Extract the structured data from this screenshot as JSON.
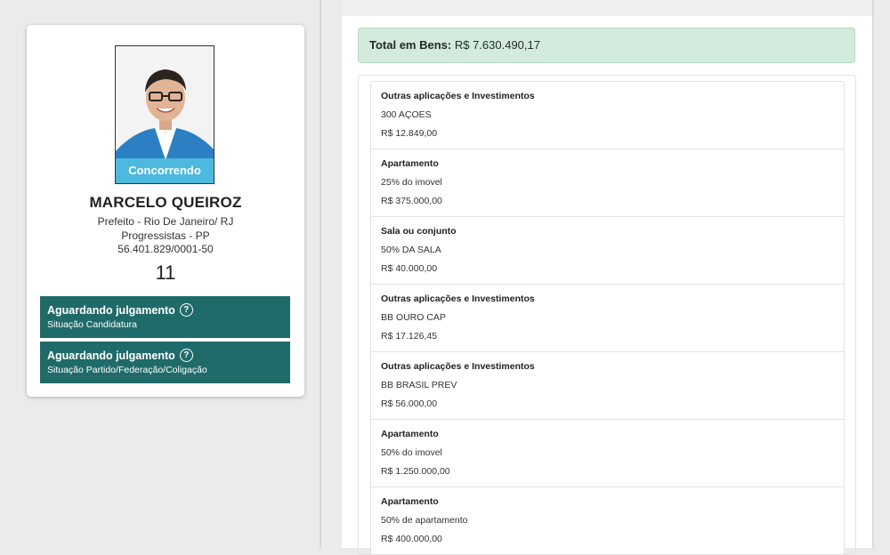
{
  "candidate": {
    "photo_status": "Concorrendo",
    "name": "MARCELO QUEIROZ",
    "office": "Prefeito - Rio De Janeiro/ RJ",
    "party": "Progressistas - PP",
    "cnpj": "56.401.829/0001-50",
    "number": "11"
  },
  "statuses": [
    {
      "title": "Aguardando julgamento",
      "subtitle": "Situação Candidatura"
    },
    {
      "title": "Aguardando julgamento",
      "subtitle": "Situação Partido/Federação/Coligação"
    }
  ],
  "total": {
    "label": "Total em Bens:",
    "value": "R$ 7.630.490,17"
  },
  "assets": [
    {
      "type": "Outras aplicações e Investimentos",
      "description": "300 AÇOES",
      "value": "R$ 12.849,00"
    },
    {
      "type": "Apartamento",
      "description": "25% do imovel",
      "value": "R$ 375.000,00"
    },
    {
      "type": "Sala ou conjunto",
      "description": "50% DA SALA",
      "value": "R$ 40.000,00"
    },
    {
      "type": "Outras aplicações e Investimentos",
      "description": "BB OURO CAP",
      "value": "R$ 17.126,45"
    },
    {
      "type": "Outras aplicações e Investimentos",
      "description": "BB BRASIL PREV",
      "value": "R$ 56.000,00"
    },
    {
      "type": "Apartamento",
      "description": "50% do imovel",
      "value": "R$ 1.250.000,00"
    },
    {
      "type": "Apartamento",
      "description": "50% de apartamento",
      "value": "R$ 400.000,00"
    }
  ],
  "icons": {
    "help": "help-circle-icon"
  },
  "colors": {
    "status_bg": "#1f6b69",
    "total_bg": "#d3ebdd",
    "photo_status_bg": "#50bee1",
    "top_bar": "#2f6f6a"
  }
}
